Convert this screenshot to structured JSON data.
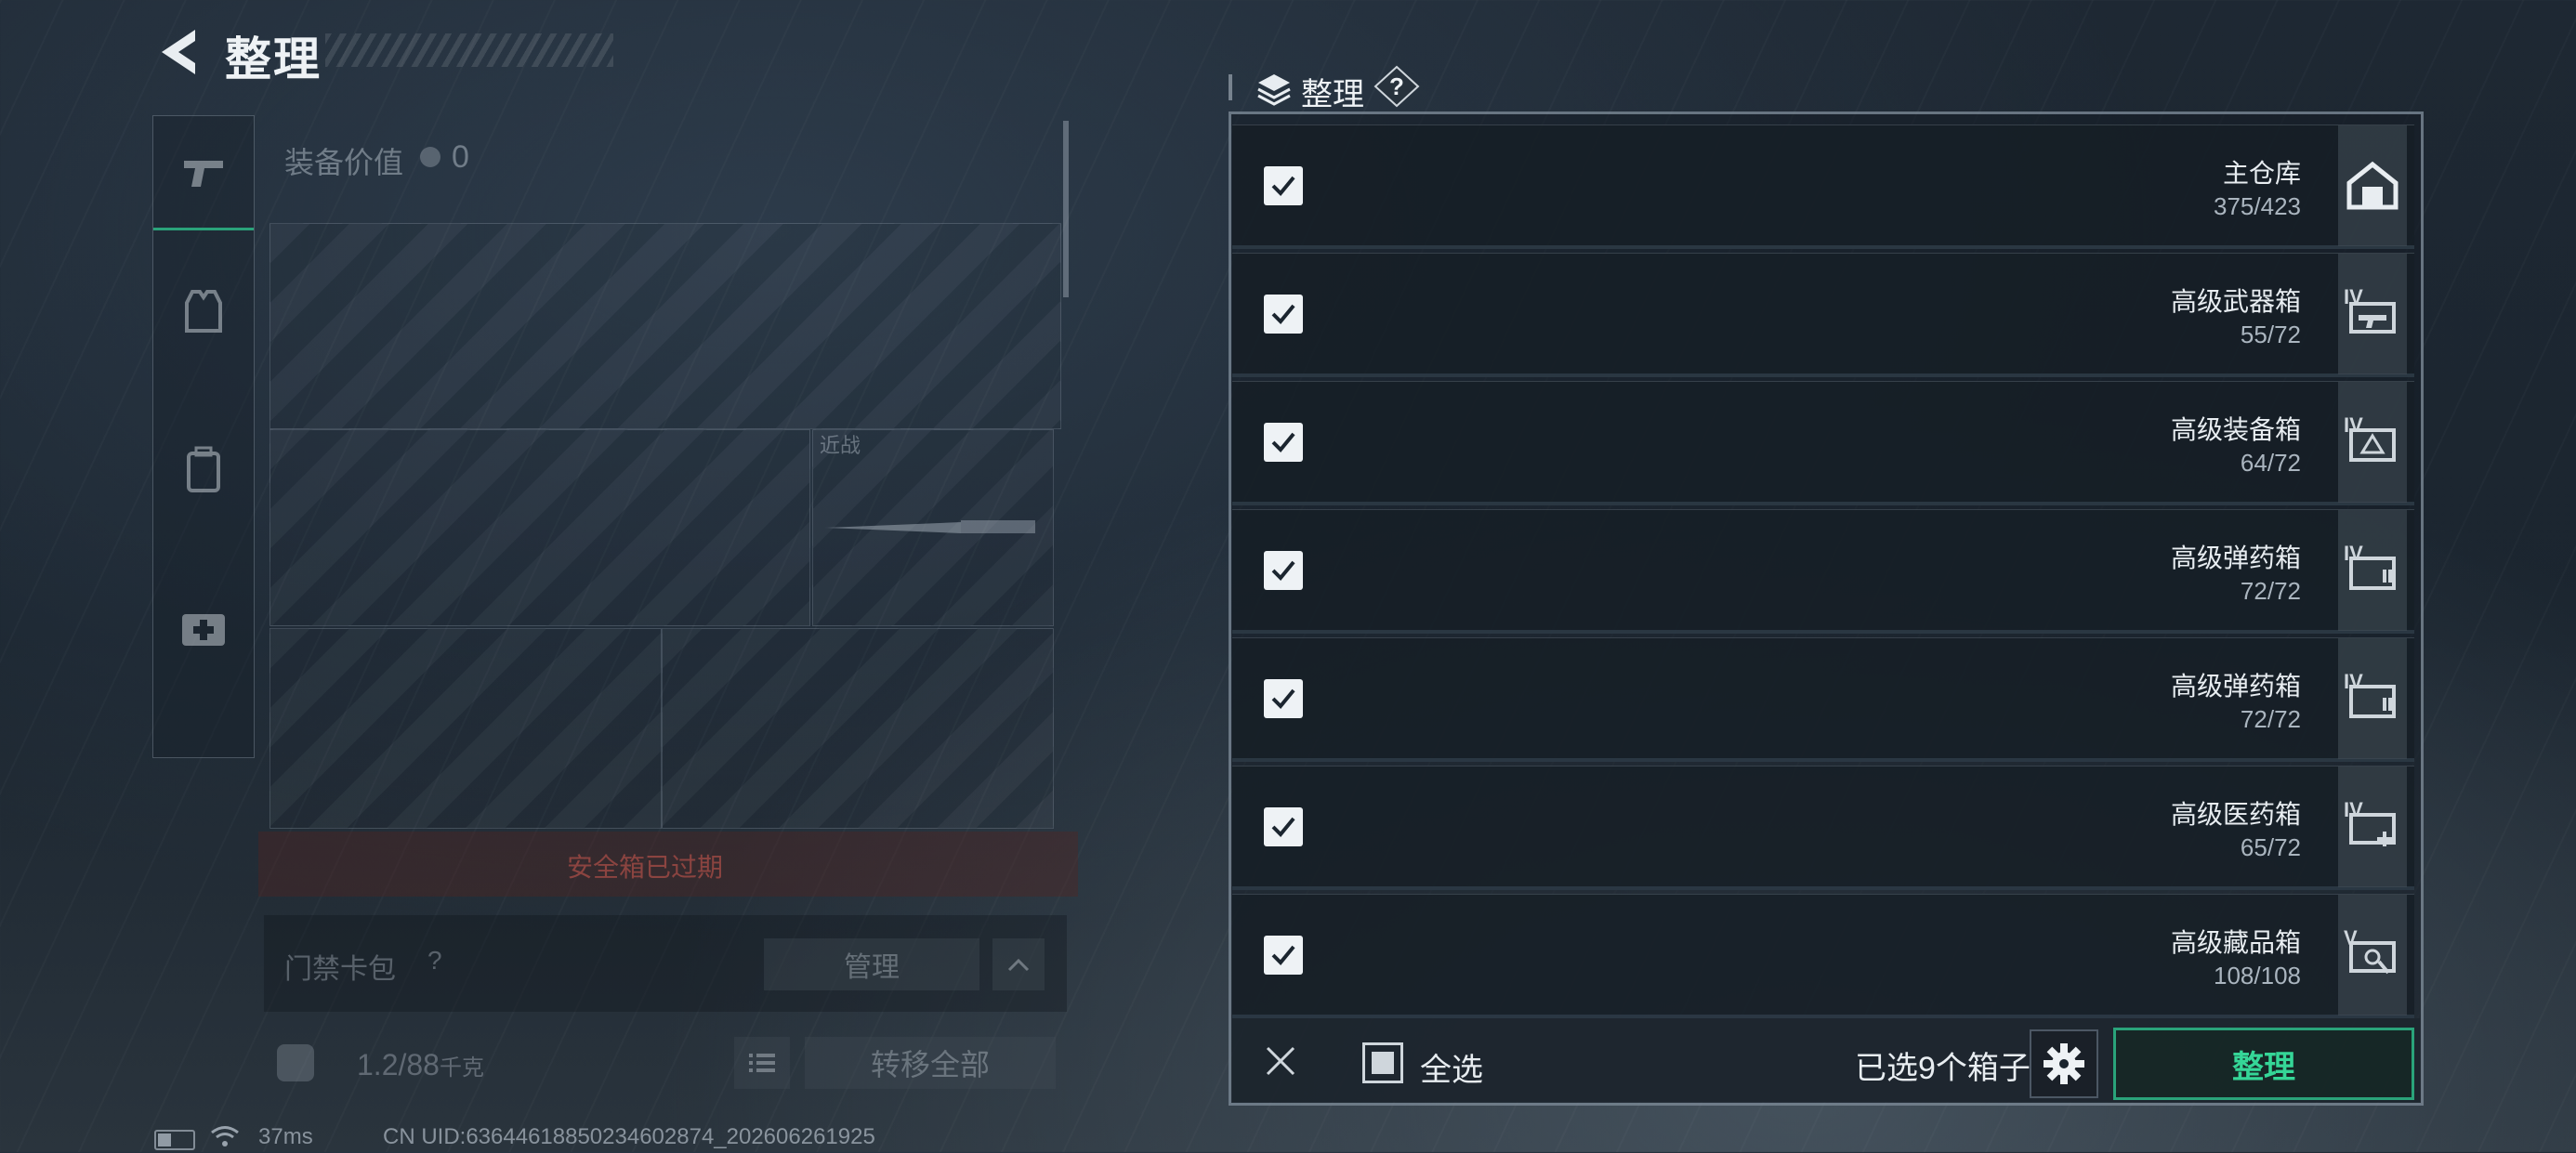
{
  "header": {
    "title": "整理"
  },
  "left_panel": {
    "equip_value_label": "装备价值",
    "equip_value": "0",
    "melee_label": "近战",
    "safe_box_status": "安全箱已过期",
    "card_pack_label": "门禁卡包",
    "card_pack_help": "?",
    "manage_label": "管理",
    "weight_value": "1.2",
    "weight_max": "/88",
    "weight_unit": "千克",
    "transfer_all_label": "转移全部"
  },
  "status_bar": {
    "ping": "37ms",
    "uid": "CN UID:636446188502346028​74_202606261925"
  },
  "organize_panel": {
    "title": "整理",
    "help": "?",
    "boxes": [
      {
        "name": "主仓库",
        "count": "375/423",
        "checked": true,
        "tier": "",
        "icon": "warehouse-icon"
      },
      {
        "name": "高级武器箱",
        "count": "55/72",
        "checked": true,
        "tier": "IV",
        "icon": "weapon-case-icon"
      },
      {
        "name": "高级装备箱",
        "count": "64/72",
        "checked": true,
        "tier": "IV",
        "icon": "gear-case-icon"
      },
      {
        "name": "高级弹药箱",
        "count": "72/72",
        "checked": true,
        "tier": "IV",
        "icon": "ammo-case-icon"
      },
      {
        "name": "高级弹药箱",
        "count": "72/72",
        "checked": true,
        "tier": "IV",
        "icon": "ammo-case-icon"
      },
      {
        "name": "高级医药箱",
        "count": "65/72",
        "checked": true,
        "tier": "IV",
        "icon": "medical-case-icon"
      },
      {
        "name": "高级藏品箱",
        "count": "108/108",
        "checked": true,
        "tier": "V",
        "icon": "collection-case-icon"
      }
    ],
    "select_all_label": "全选",
    "selected_count": "已选9个箱子",
    "organize_button": "整理"
  }
}
